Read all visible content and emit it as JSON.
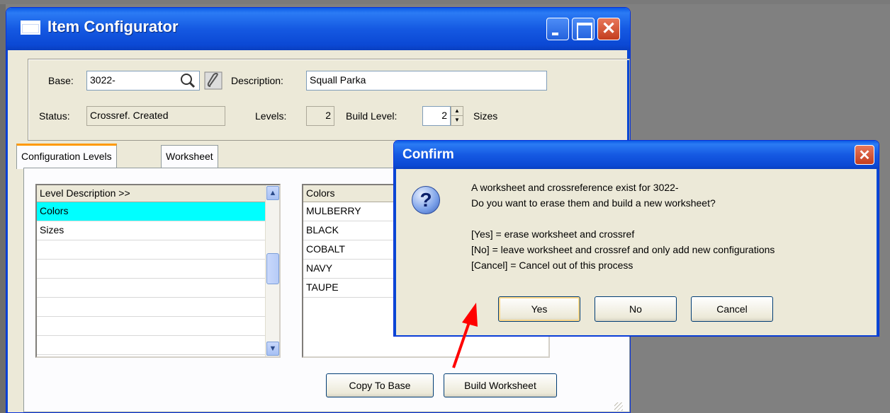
{
  "window": {
    "title": "Item Configurator",
    "controls": [
      "minimize",
      "maximize",
      "close"
    ]
  },
  "header": {
    "base_label": "Base:",
    "base_value": "3022-",
    "description_label": "Description:",
    "description_value": "Squall Parka",
    "status_label": "Status:",
    "status_value": "Crossref. Created",
    "levels_label": "Levels:",
    "levels_value": "2",
    "build_level_label": "Build Level:",
    "build_level_value": "2",
    "build_level_name": "Sizes"
  },
  "tabs": [
    {
      "label": "Configuration Levels",
      "active": true
    },
    {
      "label": "Worksheet",
      "active": false
    }
  ],
  "levels_grid": {
    "header": "Level Description >>",
    "rows": [
      "Colors",
      "Sizes",
      "",
      "",
      "",
      "",
      "",
      ""
    ],
    "selected_index": 0
  },
  "values_grid": {
    "header": "Colors",
    "rows": [
      "MULBERRY",
      "BLACK",
      "COBALT",
      "NAVY",
      "TAUPE"
    ]
  },
  "buttons": {
    "copy_to_base": "Copy To Base",
    "build_worksheet": "Build Worksheet"
  },
  "dialog": {
    "title": "Confirm",
    "lines": [
      "A worksheet and crossreference exist for 3022-",
      "Do you want to erase them and build a new worksheet?",
      "[Yes] = erase worksheet and crossref",
      "[No] = leave worksheet and crossref and only add new configurations",
      "[Cancel] = Cancel out of this process"
    ],
    "yes": "Yes",
    "no": "No",
    "cancel": "Cancel"
  },
  "annotation": {
    "arrow_color": "#ff0000"
  }
}
